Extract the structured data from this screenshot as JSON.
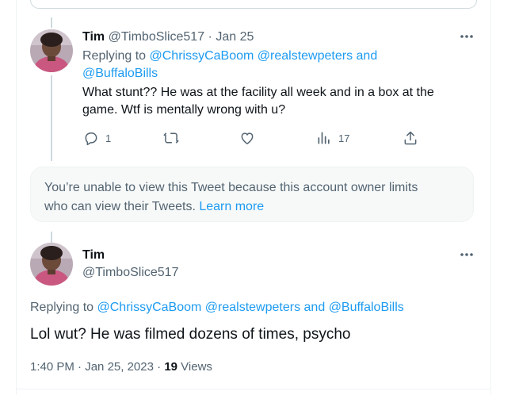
{
  "reply_tweet": {
    "display_name": "Tim",
    "handle": "@TimboSlice517",
    "separator": "·",
    "date": "Jan 25",
    "replying_prefix": "Replying to",
    "mentions": [
      "@ChrissyCaBoom",
      "@realstewpeters",
      "@BuffaloBills"
    ],
    "mention_joiner": "and",
    "text_line1": "What stunt?? He was at the facility all week and in a box at the",
    "text_line2": "game. Wtf is mentally wrong with u?",
    "actions": {
      "reply_count": "1",
      "retweet_count": "",
      "like_count": "",
      "views_count": "17"
    }
  },
  "restricted_notice": {
    "line1": "You’re unable to view this Tweet because this account owner limits",
    "line2": "who can view their Tweets.",
    "learn_more": "Learn more"
  },
  "main_tweet": {
    "display_name": "Tim",
    "handle": "@TimboSlice517",
    "replying_prefix": "Replying to",
    "mentions": [
      "@ChrissyCaBoom",
      "@realstewpeters",
      "@BuffaloBills"
    ],
    "mention_joiner": "and",
    "text": "Lol wut? He was filmed dozens of times, psycho",
    "time": "1:40 PM",
    "separator": "·",
    "date": "Jan 25, 2023",
    "views_count": "19",
    "views_label": "Views"
  },
  "colors": {
    "accent": "#1d9bf0",
    "text": "#0f1419",
    "muted": "#536471",
    "notice_bg": "#f7f9f9"
  },
  "icons": [
    "reply-icon",
    "retweet-icon",
    "like-icon",
    "views-icon",
    "share-icon",
    "more-icon"
  ]
}
